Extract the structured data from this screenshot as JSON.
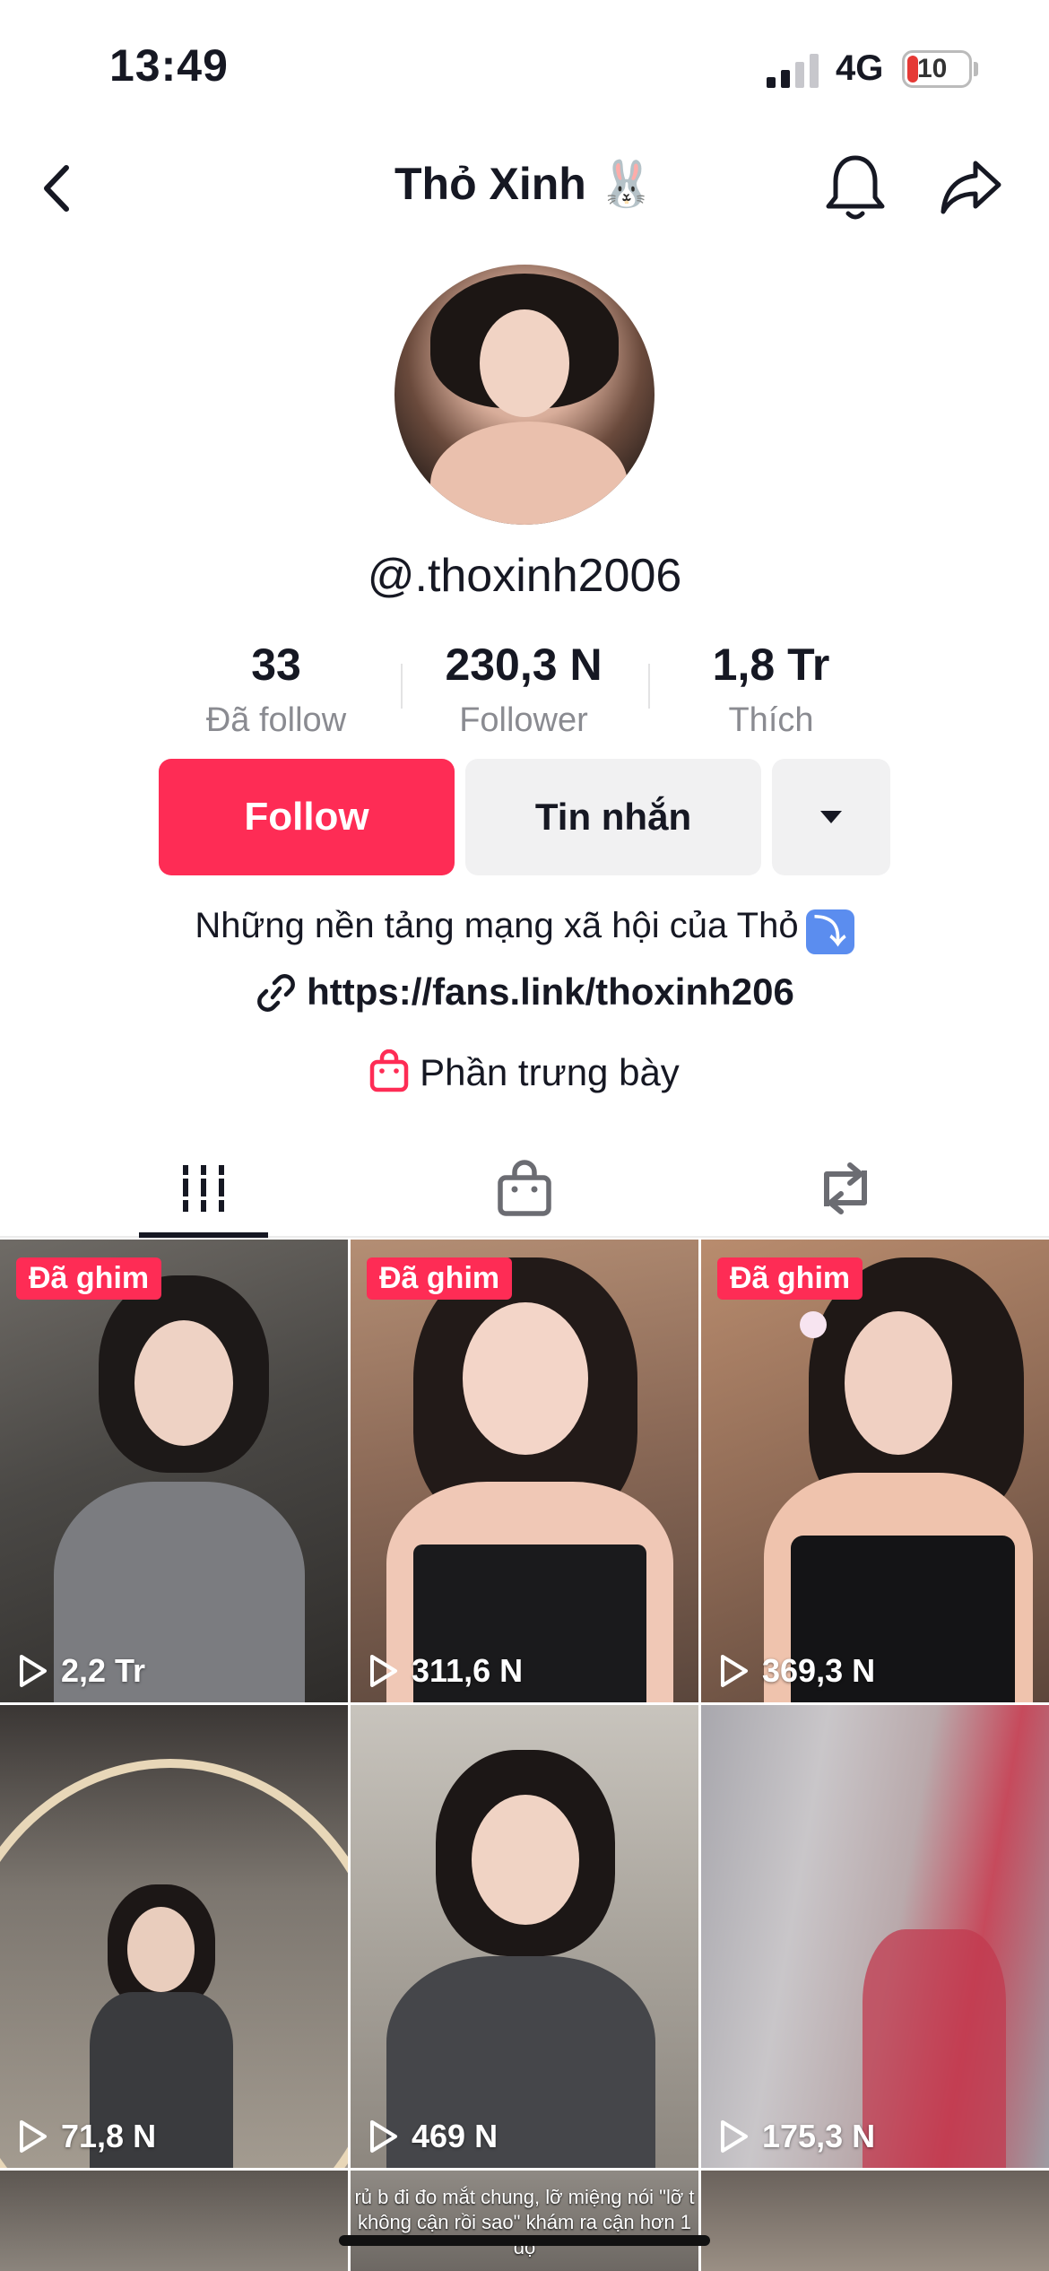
{
  "status_bar": {
    "time": "13:49",
    "network": "4G",
    "battery": "10"
  },
  "header": {
    "title": "Thỏ Xinh 🐰"
  },
  "profile": {
    "username": "@.thoxinh2006",
    "stats": [
      {
        "value": "33",
        "label": "Đã follow"
      },
      {
        "value": "230,3 N",
        "label": "Follower"
      },
      {
        "value": "1,8 Tr",
        "label": "Thích"
      }
    ],
    "follow_label": "Follow",
    "message_label": "Tin nhắn",
    "bio": "Những nền tảng mạng xã hội của Thỏ",
    "bio_emoji": "⤵",
    "link": "https://fans.link/thoxinh206",
    "showcase": "Phần trưng bày"
  },
  "tabs": [
    {
      "icon": "grid-icon",
      "active": true
    },
    {
      "icon": "shop-bag-icon",
      "active": false
    },
    {
      "icon": "repost-icon",
      "active": false
    }
  ],
  "videos": [
    {
      "pinned": true,
      "pin_label": "Đã ghim",
      "views": "2,2 Tr"
    },
    {
      "pinned": true,
      "pin_label": "Đã ghim",
      "views": "311,6 N"
    },
    {
      "pinned": true,
      "pin_label": "Đã ghim",
      "views": "369,3 N"
    },
    {
      "pinned": false,
      "views": "71,8 N"
    },
    {
      "pinned": false,
      "views": "469 N"
    },
    {
      "pinned": false,
      "views": "175,3 N"
    }
  ],
  "partial_row": {
    "caption": "rủ b đi đo mắt chung, lỡ miệng nói \"lỡ t không cận rồi sao\" khám ra cận hơn 1 độ"
  },
  "colors": {
    "accent": "#fe2c55",
    "text": "#161823",
    "muted": "#8a8b91"
  }
}
